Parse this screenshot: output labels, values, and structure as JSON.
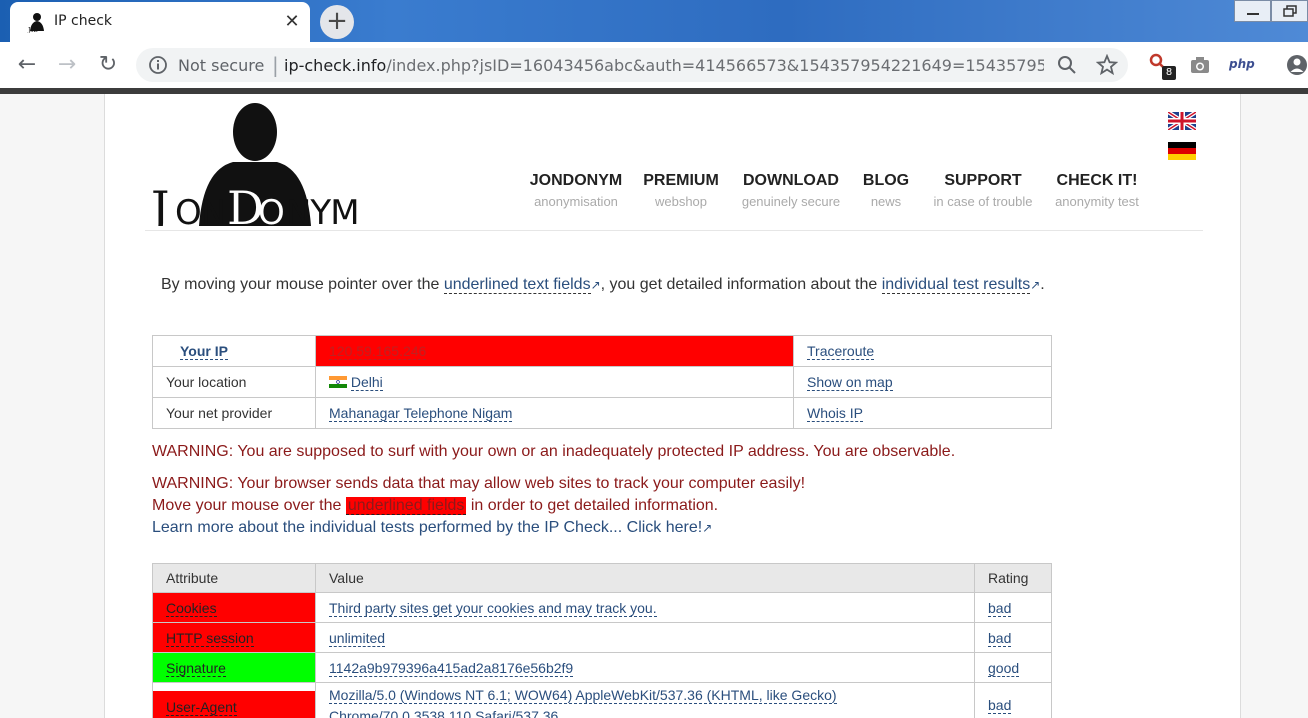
{
  "browser": {
    "tab_title": "IP check",
    "not_secure": "Not secure",
    "url_host": "ip-check.info",
    "url_path": "/index.php?jsID=16043456abc&auth=414566573&154357954221649=1543579542...",
    "ext_badge": "8",
    "ext_php": "php"
  },
  "nav": [
    {
      "title": "JONDONYM",
      "sub": "anonymisation"
    },
    {
      "title": "PREMIUM",
      "sub": "webshop"
    },
    {
      "title": "DOWNLOAD",
      "sub": "genuinely secure"
    },
    {
      "title": "BLOG",
      "sub": "news"
    },
    {
      "title": "SUPPORT",
      "sub": "in case of trouble"
    },
    {
      "title": "CHECK IT!",
      "sub": "anonymity test"
    }
  ],
  "intro": {
    "part1": "By moving your mouse pointer over the ",
    "link1": "underlined text fields",
    "part2": ", you get detailed information about the ",
    "link2": "individual test results",
    "part3": "."
  },
  "ip_table": {
    "your_ip_label": "Your IP",
    "your_ip_value": "120.59.165.246",
    "traceroute": "Traceroute",
    "location_label": "Your location",
    "location_value": "Delhi",
    "show_on_map": "Show on map",
    "provider_label": "Your net provider",
    "provider_value": "Mahanagar Telephone Nigam",
    "whois": "Whois IP"
  },
  "warnings": {
    "w1": "WARNING: You are supposed to surf with your own or an inadequately protected IP address. You are observable.",
    "w2": "WARNING: Your browser sends data that may allow web sites to track your computer easily!",
    "w3a": "Move your mouse over the ",
    "w3hl": "underlined fields",
    "w3b": " in order to get detailed information.",
    "w4": "Learn more about the individual tests performed by the IP Check... Click here!"
  },
  "attr_table": {
    "headers": {
      "attribute": "Attribute",
      "value": "Value",
      "rating": "Rating"
    },
    "rows": [
      {
        "attribute": "Cookies",
        "value": "Third party sites get your cookies and may track you.",
        "rating": "bad"
      },
      {
        "attribute": "HTTP session",
        "value": "unlimited",
        "rating": "bad"
      },
      {
        "attribute": "Signature",
        "value": "1142a9b979396a415ad2a8176e56b2f9",
        "rating": "good"
      },
      {
        "attribute": "User-Agent",
        "value": "Mozilla/5.0 (Windows NT 6.1; WOW64) AppleWebKit/537.36 (KHTML, like Gecko)",
        "value2": "Chrome/70.0.3538.110 Safari/537.36",
        "rating": "bad"
      }
    ]
  },
  "colors": {
    "bad": "#ff0000",
    "good": "#00ff00",
    "link": "#2a4e7d",
    "warning": "#8b1a1a"
  }
}
